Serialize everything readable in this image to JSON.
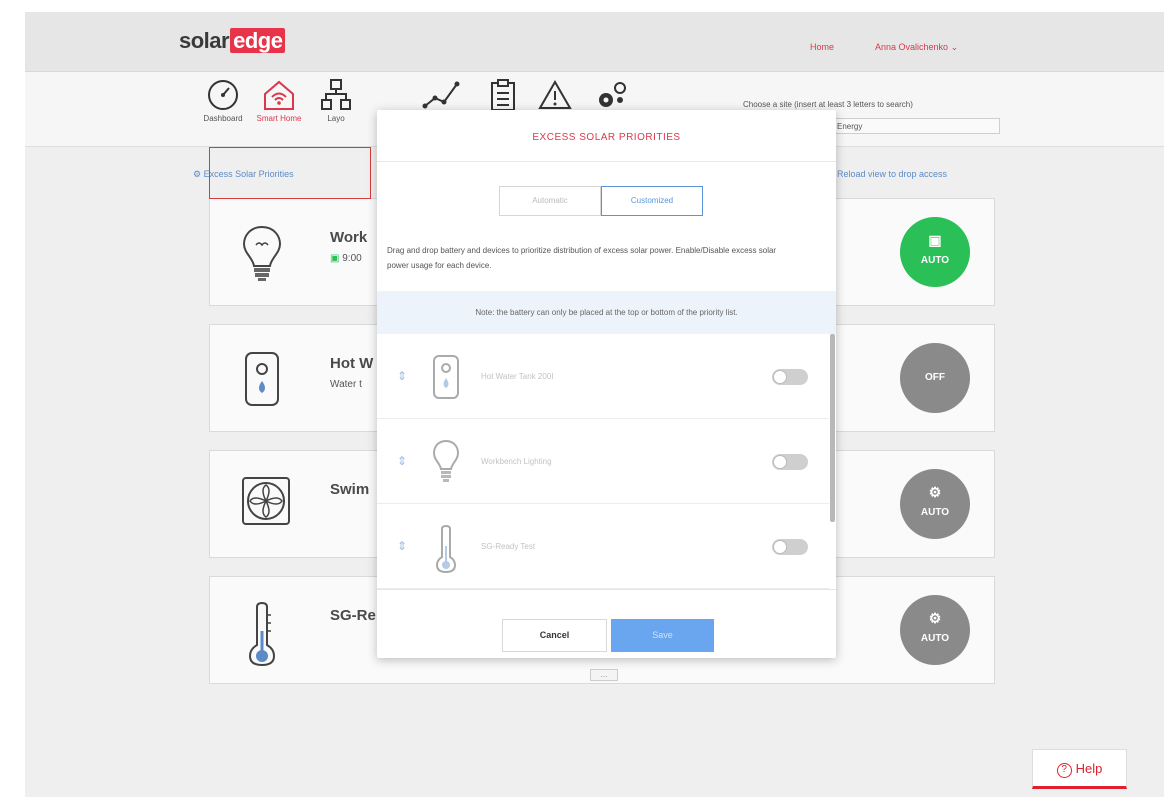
{
  "header": {
    "logo_solar": "solar",
    "logo_edge": "edge",
    "home_link": "Home",
    "user_name": "Anna Ovalichenko"
  },
  "nav": {
    "items": [
      {
        "label": "Dashboard",
        "icon": "gauge-icon"
      },
      {
        "label": "Smart Home",
        "icon": "smart-home-icon",
        "active": true
      },
      {
        "label": "Layo",
        "icon": "layout-icon"
      },
      {
        "label": "",
        "icon": "charts-icon"
      },
      {
        "label": "",
        "icon": "reports-icon"
      },
      {
        "label": "",
        "icon": "alerts-icon"
      },
      {
        "label": "",
        "icon": "admin-icon"
      }
    ],
    "site_label": "Choose a site (insert at least 3 letters to search)",
    "site_value": "Energy"
  },
  "content": {
    "excess_link": "Excess Solar Priorities",
    "reload_link": "Reload view to drop access"
  },
  "cards": [
    {
      "title": "Work",
      "subtitle": "9:00",
      "status": "AUTO",
      "status_color": "#2bbf57",
      "icon": "light-bulb-icon"
    },
    {
      "title": "Hot W",
      "subtitle": "Water t",
      "status": "OFF",
      "status_color": "#8a8a8a",
      "icon": "water-heater-icon"
    },
    {
      "title": "Swim",
      "subtitle": "",
      "status": "AUTO",
      "status_color": "#8a8a8a",
      "icon": "pool-fan-icon"
    },
    {
      "title": "SG-Re",
      "subtitle": "",
      "status": "AUTO",
      "status_color": "#8a8a8a",
      "icon": "thermometer-icon"
    }
  ],
  "modal": {
    "title": "EXCESS SOLAR PRIORITIES",
    "mode_automatic": "Automatic",
    "mode_customized": "Customized",
    "description": "Drag and drop battery and devices to prioritize distribution of excess solar power. Enable/Disable excess solar power usage for each device.",
    "note": "Note: the battery can only be placed at the top or bottom of the priority list.",
    "devices": [
      {
        "name": "Hot Water Tank 200I",
        "icon": "water-heater-icon",
        "enabled": false
      },
      {
        "name": "Workbench Lighting",
        "icon": "light-bulb-icon",
        "enabled": false
      },
      {
        "name": "SG-Ready Test",
        "icon": "thermometer-icon",
        "enabled": false
      }
    ],
    "cancel_label": "Cancel",
    "save_label": "Save",
    "more_label": "..."
  },
  "help": {
    "label": "Help"
  },
  "colors": {
    "brand_red": "#d9394b",
    "accent_blue": "#5a95dc",
    "status_green": "#2bbf57",
    "status_gray": "#8a8a8a"
  }
}
